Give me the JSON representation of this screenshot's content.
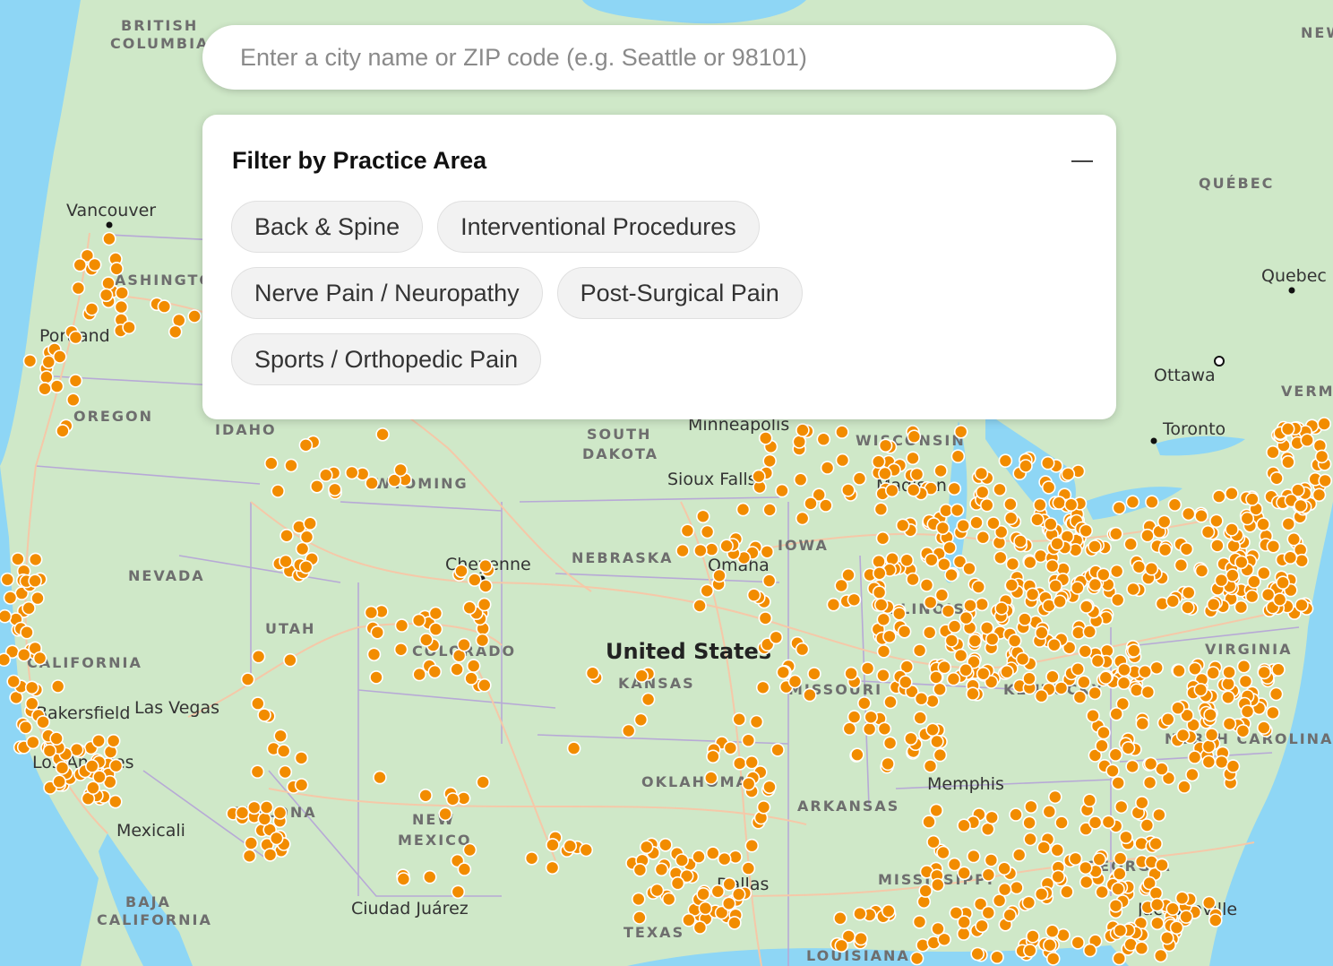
{
  "search": {
    "placeholder": "Enter a city name or ZIP code (e.g. Seattle or 98101)",
    "value": ""
  },
  "filter": {
    "title": "Filter by Practice Area",
    "collapse_icon": "minus-icon",
    "options": [
      "Back & Spine",
      "Interventional Procedures",
      "Nerve Pain / Neuropathy",
      "Post-Surgical Pain",
      "Sports / Orthopedic Pain"
    ]
  },
  "map": {
    "country_label": "United States",
    "region_labels": [
      "BRITISH COLUMBIA",
      "WASHINGTON",
      "OREGON",
      "IDAHO",
      "NEVADA",
      "CALIFORNIA",
      "UTAH",
      "ARIZONA",
      "WYOMING",
      "COLORADO",
      "NEW MEXICO",
      "SOUTH DAKOTA",
      "NEBRASKA",
      "KANSAS",
      "OKLAHOMA",
      "TEXAS",
      "IOWA",
      "MISSOURI",
      "ARKANSAS",
      "ILLINOIS",
      "WISCONSIN",
      "KENTUCKY",
      "MISSISSIPPI",
      "LOUISIANA",
      "VIRGINIA",
      "NORTH CAROLINA",
      "GEORGIA",
      "QUÉBEC",
      "VERMONT",
      "BAJA CALIFORNIA",
      "NEW"
    ],
    "city_labels": [
      "Vancouver",
      "Portland",
      "Bakersfield",
      "Las Vegas",
      "Los Angeles",
      "Mexicali",
      "Cheyenne",
      "Sioux Falls",
      "Omaha",
      "Minneapolis",
      "Madison",
      "Memphis",
      "Dallas",
      "Ciudad Juárez",
      "Toronto",
      "Ottawa",
      "Quebec",
      "Jacksonville"
    ],
    "marker_color": "#f28c00",
    "marker_border": "#ffffff",
    "land_color": "#cfe8c8",
    "water_color": "#8ed6f5"
  }
}
